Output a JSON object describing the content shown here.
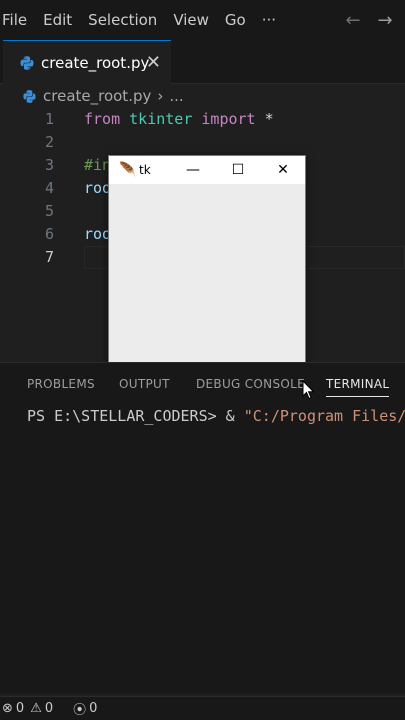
{
  "menubar": {
    "items": [
      "File",
      "Edit",
      "Selection",
      "View",
      "Go",
      "···"
    ],
    "icons": [
      "arrow-left-icon",
      "arrow-right-icon"
    ]
  },
  "tab": {
    "label": "create_root.py",
    "close": "✕"
  },
  "breadcrumb": {
    "file": "create_root.py",
    "separator": "›",
    "more": "..."
  },
  "editor": {
    "lines": [
      {
        "num": "1",
        "tokens": [
          [
            "kw",
            "from"
          ],
          [
            "op",
            " "
          ],
          [
            "id",
            "tkinter"
          ],
          [
            "op",
            " "
          ],
          [
            "kw",
            "import"
          ],
          [
            "op",
            " *"
          ]
        ]
      },
      {
        "num": "2",
        "tokens": []
      },
      {
        "num": "3",
        "tokens": [
          [
            "cm",
            "#in"
          ]
        ]
      },
      {
        "num": "4",
        "tokens": [
          [
            "var",
            "roo"
          ]
        ]
      },
      {
        "num": "5",
        "tokens": []
      },
      {
        "num": "6",
        "tokens": [
          [
            "var",
            "roo"
          ]
        ]
      },
      {
        "num": "7",
        "tokens": []
      }
    ],
    "active_line": 7
  },
  "tkwindow": {
    "title": "tk",
    "minimize": "—",
    "maximize": "☐",
    "close": "✕"
  },
  "panel": {
    "tabs": [
      "PROBLEMS",
      "OUTPUT",
      "DEBUG CONSOLE",
      "TERMINAL"
    ],
    "active_tab": "TERMINAL",
    "terminal": {
      "prompt": "PS E:\\STELLAR_CODERS> & ",
      "command": "\"C:/Program Files/P"
    }
  },
  "statusbar": {
    "errors": "0",
    "warnings": "0",
    "ports": "0"
  },
  "colors": {
    "accent": "#0078d4",
    "background": "#1f1f1f",
    "sidebar": "#181818"
  }
}
